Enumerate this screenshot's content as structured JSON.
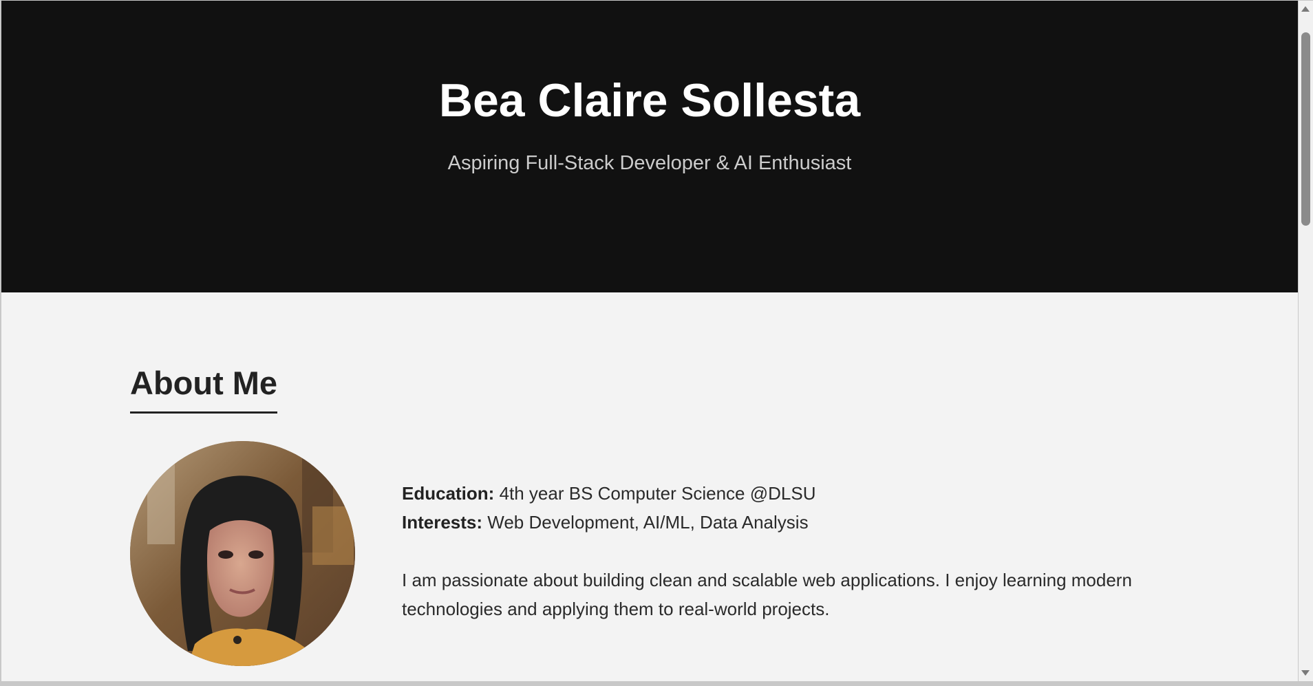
{
  "hero": {
    "name": "Bea Claire Sollesta",
    "tagline": "Aspiring Full-Stack Developer & AI Enthusiast"
  },
  "about": {
    "heading": "About Me",
    "photo_alt": "Profile photo of Bea Claire Sollesta",
    "education_label": "Education:",
    "education_value": " 4th year BS Computer Science @DLSU",
    "interests_label": "Interests:",
    "interests_value": " Web Development, AI/ML, Data Analysis",
    "bio": "I am passionate about building clean and scalable web applications. I enjoy learning modern technologies and applying them to real-world projects."
  },
  "colors": {
    "hero_background": "#111111",
    "page_background": "#f3f3f3",
    "text": "#222222"
  }
}
